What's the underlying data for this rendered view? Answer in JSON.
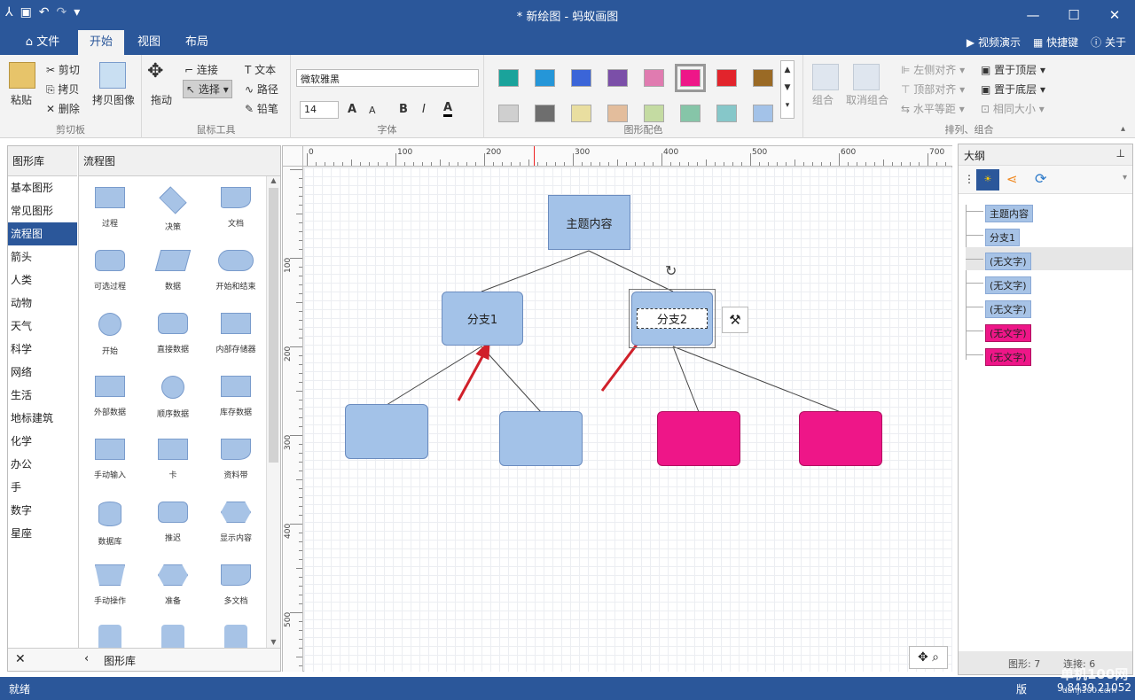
{
  "window": {
    "title": "* 新绘图 - 蚂蚁画图",
    "minimize": "—",
    "maximize": "☐",
    "close": "✕"
  },
  "tabs": {
    "file": "文件",
    "home": "开始",
    "view": "视图",
    "layout": "布局"
  },
  "top_right": {
    "video": "视频演示",
    "shortcut": "快捷键",
    "about": "关于"
  },
  "ribbon": {
    "clipboard": {
      "label": "剪切板",
      "paste": "粘贴",
      "cut": "剪切",
      "copy": "拷贝",
      "delete": "删除",
      "copy_image": "拷贝图像"
    },
    "mouse": {
      "label": "鼠标工具",
      "drag": "拖动",
      "connect": "连接",
      "select": "选择",
      "text": "文本",
      "path": "路径",
      "pencil": "铅笔"
    },
    "font": {
      "label": "字体",
      "family": "微软雅黑",
      "size": "14",
      "bold": "B",
      "italic": "I",
      "color": "A",
      "grow": "A",
      "shrink": "A"
    },
    "colors": {
      "label": "图形配色",
      "row1": [
        "#1aa39b",
        "#2596d8",
        "#3b65d8",
        "#7b4fa8",
        "#e07bb0",
        "#ee1688",
        "#e2242c",
        "#9a6a25"
      ],
      "row2": [
        "#cfcfcf",
        "#6e6e6e",
        "#e9dea0",
        "#e3bd9c",
        "#c4dba2",
        "#86c5a8",
        "#86c7c9",
        "#a3c2e8"
      ]
    },
    "arrange": {
      "label": "排列、组合",
      "group": "组合",
      "ungroup": "取消组合",
      "align_left": "左侧对齐",
      "align_top": "顶部对齐",
      "h_distribute": "水平等距",
      "to_top": "置于顶层",
      "to_bottom": "置于底层",
      "same_size": "相同大小"
    }
  },
  "library": {
    "title": "图形库",
    "category_title": "流程图",
    "categories": [
      "基本图形",
      "常见图形",
      "流程图",
      "箭头",
      "人类",
      "动物",
      "天气",
      "科学",
      "网络",
      "生活",
      "地标建筑",
      "化学",
      "办公",
      "手",
      "数字",
      "星座"
    ],
    "selected": "流程图",
    "shapes": [
      "过程",
      "决策",
      "文档",
      "可选过程",
      "数据",
      "开始和结束",
      "开始",
      "直接数据",
      "内部存储器",
      "外部数据",
      "顺序数据",
      "库存数据",
      "手动输入",
      "卡",
      "资料带",
      "数据库",
      "推迟",
      "显示内容",
      "手动操作",
      "准备",
      "多文档"
    ],
    "footer": "图形库",
    "close": "✕"
  },
  "ruler": {
    "h": [
      "0",
      "100",
      "200",
      "300",
      "400",
      "500",
      "600",
      "700"
    ],
    "v": [
      "100",
      "200",
      "300",
      "400",
      "500"
    ]
  },
  "diagram": {
    "root": "主题内容",
    "branch1": "分支1",
    "branch2": "分支2"
  },
  "outline": {
    "title": "大纲",
    "items": [
      "主题内容",
      "分支1",
      "(无文字)",
      "(无文字)",
      "(无文字)",
      "(无文字)",
      "(无文字)"
    ],
    "stats_shapes": "图形: 7",
    "stats_links": "连接: 6"
  },
  "status": {
    "text": "就绪",
    "version": "版",
    "coords": "9.8439.21052",
    "watermark": "单机100网",
    "watermark2": "danji100.com"
  }
}
